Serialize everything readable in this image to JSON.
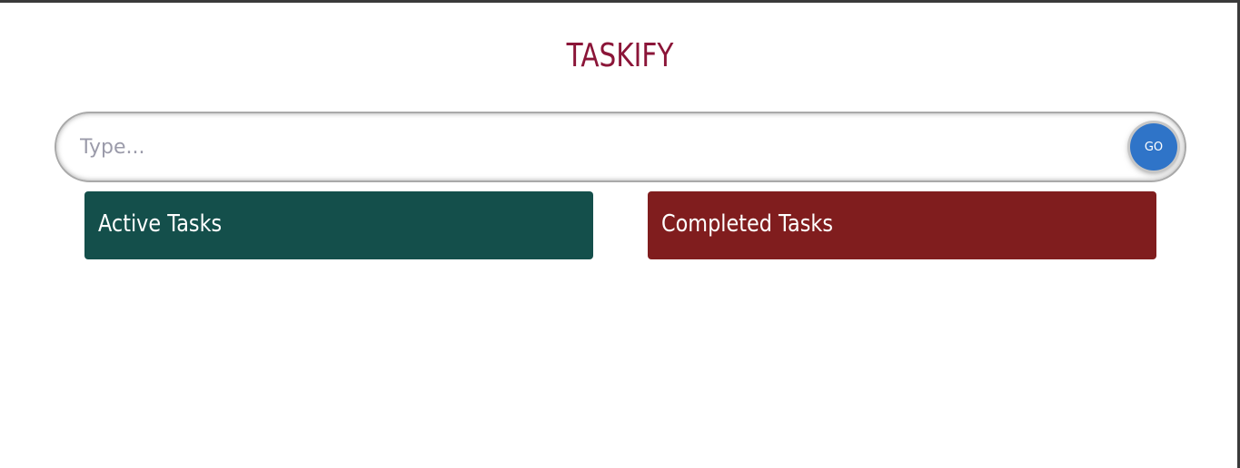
{
  "app": {
    "title": "TASKIFY",
    "title_color": "#8b1538"
  },
  "task_form": {
    "input_placeholder": "Type...",
    "input_value": "",
    "submit_label": "GO",
    "submit_color": "#2f74c8"
  },
  "panels": {
    "active": {
      "heading": "Active Tasks",
      "color": "#144f4b"
    },
    "completed": {
      "heading": "Completed Tasks",
      "color": "#801d1e"
    }
  }
}
